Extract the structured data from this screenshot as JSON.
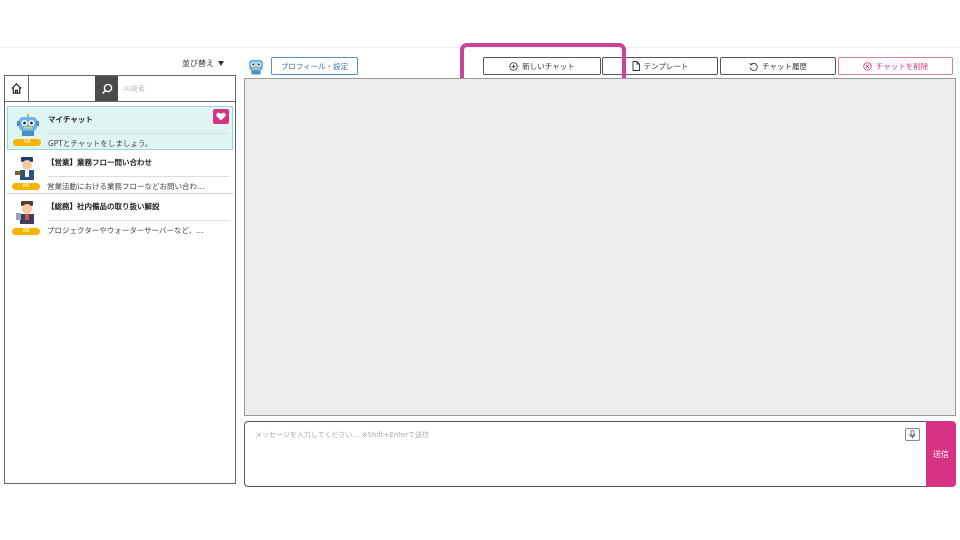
{
  "sidebar": {
    "sort_label": "並び替え",
    "search_placeholder": "AI検索",
    "items": [
      {
        "title": "マイチャット",
        "description": "GPTとチャットをしましょう。",
        "badge": "AB",
        "favorite": true
      },
      {
        "title": "【営業】業務フロー問い合わせ",
        "description": "営業活動における業務フローなどお問い合わ…",
        "badge": "AB"
      },
      {
        "title": "【総務】社内備品の取り扱い解説",
        "description": "プロジェクターやウォーターサーバーなど、…",
        "badge": "AB"
      }
    ]
  },
  "header": {
    "profile_label": "プロフィール・設定",
    "new_chat_label": "新しいチャット",
    "template_label": "テンプレート",
    "history_label": "チャット履歴",
    "delete_label": "チャットを削除"
  },
  "composer": {
    "placeholder": "メッセージを入力してください… ※Shift+Enterで送信",
    "send_label": "送信"
  },
  "colors": {
    "accent": "#d63384",
    "highlight_frame": "#c9449b",
    "active_item_bg": "#def5f4",
    "badge": "#f5b400",
    "profile_blue": "#3d6fb0"
  },
  "icons": [
    "home-icon",
    "search-icon",
    "heart-icon",
    "plus-circle-icon",
    "document-icon",
    "history-icon",
    "close-circle-icon",
    "microphone-icon",
    "sort-caret-icon"
  ]
}
